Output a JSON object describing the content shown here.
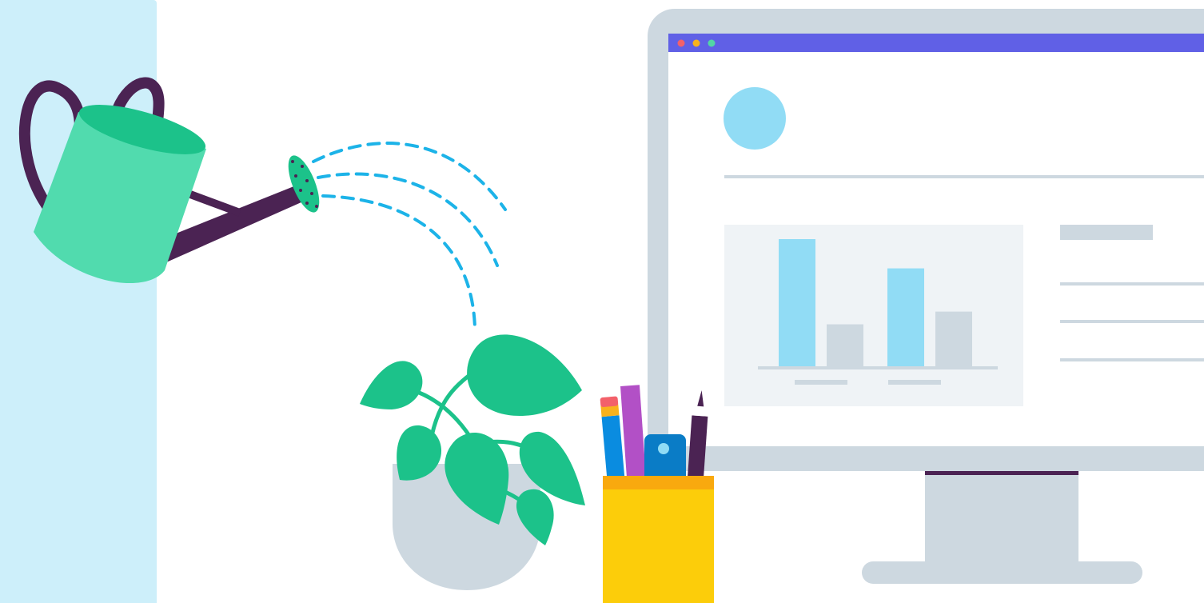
{
  "colors": {
    "background": "#ffffff",
    "side_band": "#cdeffa",
    "monitor_frame": "#cdd8e0",
    "screen_bg": "#ffffff",
    "titlebar": "#6060e6",
    "dot_red": "#f3616a",
    "dot_yellow": "#f9b21d",
    "dot_green": "#52d6a6",
    "avatar": "#91dcf5",
    "bar_blue": "#91dcf5",
    "bar_grey": "#cdd8e0",
    "chart_panel": "#eff3f6",
    "stand_dark": "#4b2353",
    "plant_leaf": "#1cc28a",
    "pot": "#cdd8e0",
    "can_body": "#51dbae",
    "can_top": "#1cc28a",
    "can_handle": "#4b2353",
    "water": "#1cb3e8",
    "cup": "#fccd0a",
    "cup_rim": "#f9a90e"
  },
  "icons": {
    "watering_can": "watering-can-icon",
    "plant": "potted-plant-icon",
    "pencil_cup": "pencil-cup-icon",
    "monitor": "desktop-monitor-icon"
  },
  "chart_data": {
    "type": "bar",
    "categories": [
      "",
      ""
    ],
    "series": [
      {
        "values": [
          100,
          77
        ]
      },
      {
        "values": [
          33,
          43
        ]
      }
    ],
    "title": "",
    "xlabel": "",
    "ylabel": "",
    "ylim": [
      0,
      100
    ],
    "grid": false
  }
}
